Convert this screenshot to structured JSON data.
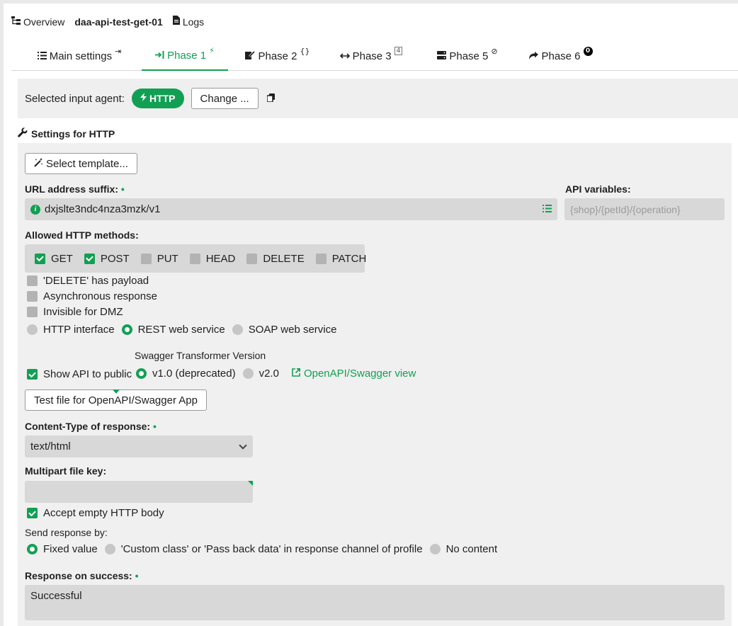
{
  "breadcrumb": {
    "overview": "Overview",
    "profile": "daa-api-test-get-01",
    "logs": "Logs"
  },
  "tabs": [
    {
      "label": "Main settings",
      "sup": "⇥"
    },
    {
      "label": "Phase 1",
      "sup": "⚡"
    },
    {
      "label": "Phase 2",
      "sup": "{}"
    },
    {
      "label": "Phase 3",
      "sup": "4"
    },
    {
      "label": "Phase 5",
      "sup": "⊘"
    },
    {
      "label": "Phase 6",
      "sup": "0"
    }
  ],
  "agent": {
    "label": "Selected input agent:",
    "name": "HTTP",
    "change": "Change ..."
  },
  "settings_title": "Settings for HTTP",
  "template_button": "Select template...",
  "url": {
    "label": "URL address suffix:",
    "value": "dxjslte3ndc4nza3mzk/v1"
  },
  "api_vars": {
    "label": "API variables:",
    "placeholder": "{shop}/{petId}/{operation}"
  },
  "methods": {
    "label": "Allowed HTTP methods:",
    "items": [
      {
        "label": "GET",
        "checked": true
      },
      {
        "label": "POST",
        "checked": true
      },
      {
        "label": "PUT",
        "checked": false
      },
      {
        "label": "HEAD",
        "checked": false
      },
      {
        "label": "DELETE",
        "checked": false
      },
      {
        "label": "PATCH",
        "checked": false
      }
    ]
  },
  "options": {
    "delete_payload": "'DELETE' has payload",
    "async": "Asynchronous response",
    "invisible_dmz": "Invisible for DMZ"
  },
  "interface": {
    "http": "HTTP interface",
    "rest": "REST web service",
    "soap": "SOAP web service"
  },
  "swagger": {
    "label": "Swagger Transformer Version",
    "show_api": "Show API to public",
    "v1": "v1.0 (deprecated)",
    "v2": "v2.0",
    "view_link": "OpenAPI/Swagger view",
    "test_file": "Test file for OpenAPI/Swagger App"
  },
  "content_type": {
    "label": "Content-Type of response:",
    "value": "text/html"
  },
  "multipart": {
    "label": "Multipart file key:",
    "value": ""
  },
  "accept_empty": "Accept empty HTTP body",
  "send_response": {
    "label": "Send response by:",
    "fixed": "Fixed value",
    "custom": "'Custom class' or 'Pass back data' in response channel of profile",
    "none": "No content"
  },
  "response_success": {
    "label": "Response on success:",
    "value": "Successful"
  },
  "colors": {
    "accent": "#11a053",
    "panel": "#f0f0f0",
    "field": "#d8d8d8"
  }
}
